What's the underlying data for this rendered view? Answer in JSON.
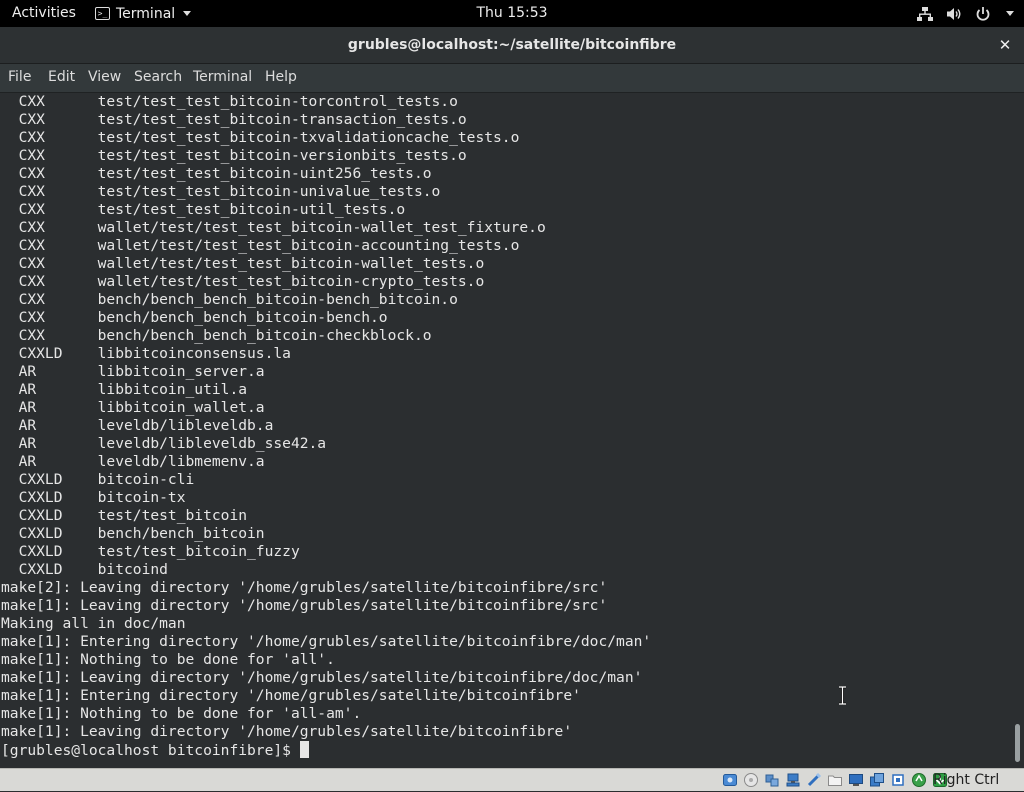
{
  "topbar": {
    "activities": "Activities",
    "app_name": "Terminal",
    "clock": "Thu 15:53"
  },
  "window": {
    "title": "grubles@localhost:~/satellite/bitcoinfibre",
    "close_glyph": "✕"
  },
  "menu": {
    "items": [
      "File",
      "Edit",
      "View",
      "Search",
      "Terminal",
      "Help"
    ]
  },
  "terminal": {
    "lines": [
      "  CXX      test/test_test_bitcoin-torcontrol_tests.o",
      "  CXX      test/test_test_bitcoin-transaction_tests.o",
      "  CXX      test/test_test_bitcoin-txvalidationcache_tests.o",
      "  CXX      test/test_test_bitcoin-versionbits_tests.o",
      "  CXX      test/test_test_bitcoin-uint256_tests.o",
      "  CXX      test/test_test_bitcoin-univalue_tests.o",
      "  CXX      test/test_test_bitcoin-util_tests.o",
      "  CXX      wallet/test/test_test_bitcoin-wallet_test_fixture.o",
      "  CXX      wallet/test/test_test_bitcoin-accounting_tests.o",
      "  CXX      wallet/test/test_test_bitcoin-wallet_tests.o",
      "  CXX      wallet/test/test_test_bitcoin-crypto_tests.o",
      "  CXX      bench/bench_bench_bitcoin-bench_bitcoin.o",
      "  CXX      bench/bench_bench_bitcoin-bench.o",
      "  CXX      bench/bench_bench_bitcoin-checkblock.o",
      "  CXXLD    libbitcoinconsensus.la",
      "  AR       libbitcoin_server.a",
      "  AR       libbitcoin_util.a",
      "  AR       libbitcoin_wallet.a",
      "  AR       leveldb/libleveldb.a",
      "  AR       leveldb/libleveldb_sse42.a",
      "  AR       leveldb/libmemenv.a",
      "  CXXLD    bitcoin-cli",
      "  CXXLD    bitcoin-tx",
      "  CXXLD    test/test_bitcoin",
      "  CXXLD    bench/bench_bitcoin",
      "  CXXLD    test/test_bitcoin_fuzzy",
      "  CXXLD    bitcoind",
      "make[2]: Leaving directory '/home/grubles/satellite/bitcoinfibre/src'",
      "make[1]: Leaving directory '/home/grubles/satellite/bitcoinfibre/src'",
      "Making all in doc/man",
      "make[1]: Entering directory '/home/grubles/satellite/bitcoinfibre/doc/man'",
      "make[1]: Nothing to be done for 'all'.",
      "make[1]: Leaving directory '/home/grubles/satellite/bitcoinfibre/doc/man'",
      "make[1]: Entering directory '/home/grubles/satellite/bitcoinfibre'",
      "make[1]: Nothing to be done for 'all-am'.",
      "make[1]: Leaving directory '/home/grubles/satellite/bitcoinfibre'"
    ],
    "prompt": "[grubles@localhost bitcoinfibre]$ "
  },
  "vbox": {
    "host_key": "Right Ctrl",
    "icons": [
      "hard-disk-icon",
      "optical-drive-icon",
      "audio-icon",
      "network-icon",
      "usb-icon",
      "shared-folder-icon",
      "display-icon",
      "video-capture-icon",
      "cpu-icon",
      "mouse-integration-icon"
    ]
  },
  "colors": {
    "terminal_bg": "#2b2e30",
    "terminal_fg": "#e6e6e6",
    "topbar_bg": "#000000",
    "menubar_bg": "#33393b"
  }
}
